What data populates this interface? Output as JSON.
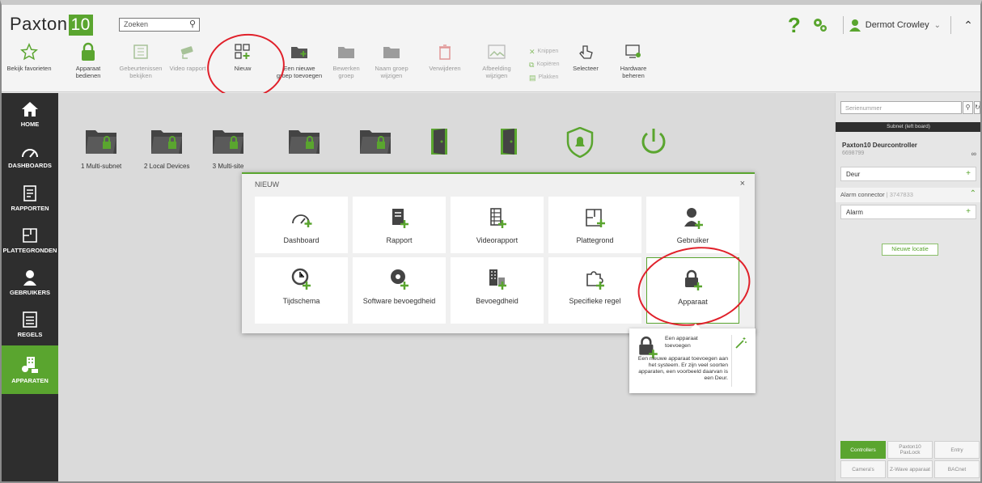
{
  "app": {
    "logo_text": "Paxton",
    "logo_num": "10"
  },
  "search": {
    "placeholder": "Zoeken"
  },
  "header": {
    "help_glyph": "?",
    "user_name": "Dermot Crowley"
  },
  "ribbon": [
    {
      "label": "Bekijk favorieten",
      "icon": "star-icon"
    },
    {
      "label": "Apparaat bedienen",
      "icon": "lock-icon"
    },
    {
      "label": "Gebeurtenissen bekijken",
      "icon": "events-icon"
    },
    {
      "label": "Video rapport",
      "icon": "camera-icon"
    },
    {
      "label": "Nieuw",
      "icon": "new-grid-icon"
    },
    {
      "label": "Een nieuwe groep toevoegen",
      "icon": "add-group-folder-icon"
    },
    {
      "label": "Bewerken groep",
      "icon": "edit-group-icon"
    },
    {
      "label": "Naam groep wijzigen",
      "icon": "rename-group-icon"
    },
    {
      "label": "Verwijderen",
      "icon": "trash-icon"
    },
    {
      "label": "Afbeelding wijzigen",
      "icon": "image-icon"
    },
    {
      "label": "Selecteer",
      "icon": "pointer-hand-icon"
    },
    {
      "label": "Hardware beheren",
      "icon": "hardware-icon"
    }
  ],
  "clipboard": {
    "cut": "Knippen",
    "copy": "Kopiëren",
    "paste": "Plakken"
  },
  "nav": [
    {
      "label": "HOME"
    },
    {
      "label": "DASHBOARDS"
    },
    {
      "label": "RAPPORTEN"
    },
    {
      "label": "PLATTEGRONDEN"
    },
    {
      "label": "GEBRUIKERS"
    },
    {
      "label": "REGELS"
    },
    {
      "label": "APPARATEN"
    }
  ],
  "tiles": [
    {
      "label": "1 Multi-subnet",
      "icon": "folder-lock-icon"
    },
    {
      "label": "2 Local Devices",
      "icon": "folder-lock-icon"
    },
    {
      "label": "3 Multi-site",
      "icon": "folder-lock-icon"
    },
    {
      "label": "",
      "icon": "folder-lock-icon"
    },
    {
      "label": "",
      "icon": "folder-lock-icon"
    },
    {
      "label": "",
      "icon": "door-icon"
    },
    {
      "label": "",
      "icon": "door-icon"
    },
    {
      "label": "",
      "icon": "alarm-shield-icon"
    },
    {
      "label": "",
      "icon": "power-icon"
    }
  ],
  "dialog": {
    "title": "NIEUW",
    "close": "×",
    "items": [
      {
        "label": "Dashboard",
        "icon": "dashboard-add-icon"
      },
      {
        "label": "Rapport",
        "icon": "report-add-icon"
      },
      {
        "label": "Videorapport",
        "icon": "video-report-add-icon"
      },
      {
        "label": "Plattegrond",
        "icon": "floorplan-add-icon"
      },
      {
        "label": "Gebruiker",
        "icon": "user-add-icon"
      },
      {
        "label": "Tijdschema",
        "icon": "clock-add-icon"
      },
      {
        "label": "Software bevoegdheid",
        "icon": "disc-add-icon"
      },
      {
        "label": "Bevoegdheid",
        "icon": "building-add-icon"
      },
      {
        "label": "Specifieke regel",
        "icon": "puzzle-add-icon"
      },
      {
        "label": "Apparaat",
        "icon": "lock-add-icon"
      }
    ]
  },
  "tooltip": {
    "title": "Een apparaat toevoegen",
    "body": "Een nieuwe apparaat toevoegen aan het systeem. Er zijn veel soorten apparaten, een voorbeeld daarvan is een Deur."
  },
  "right": {
    "search_placeholder": "Serienummer",
    "subnet": "Subnet (left board)",
    "controller_name": "Paxton10 Deurcontroller",
    "controller_serial": "6698799",
    "deur": "Deur",
    "alarm_connector": "Alarm connector",
    "alarm_serial": "3747833",
    "alarm": "Alarm",
    "new_location": "Nieuwe locatie",
    "tabs": [
      "Controllers",
      "Paxton10 PaxLock",
      "Entry",
      "Camera's",
      "Z-Wave apparaat",
      "BACnet"
    ]
  },
  "colors": {
    "accent": "#5aa52f",
    "nav_bg": "#2e2e2e",
    "annotation": "#e0202a"
  }
}
